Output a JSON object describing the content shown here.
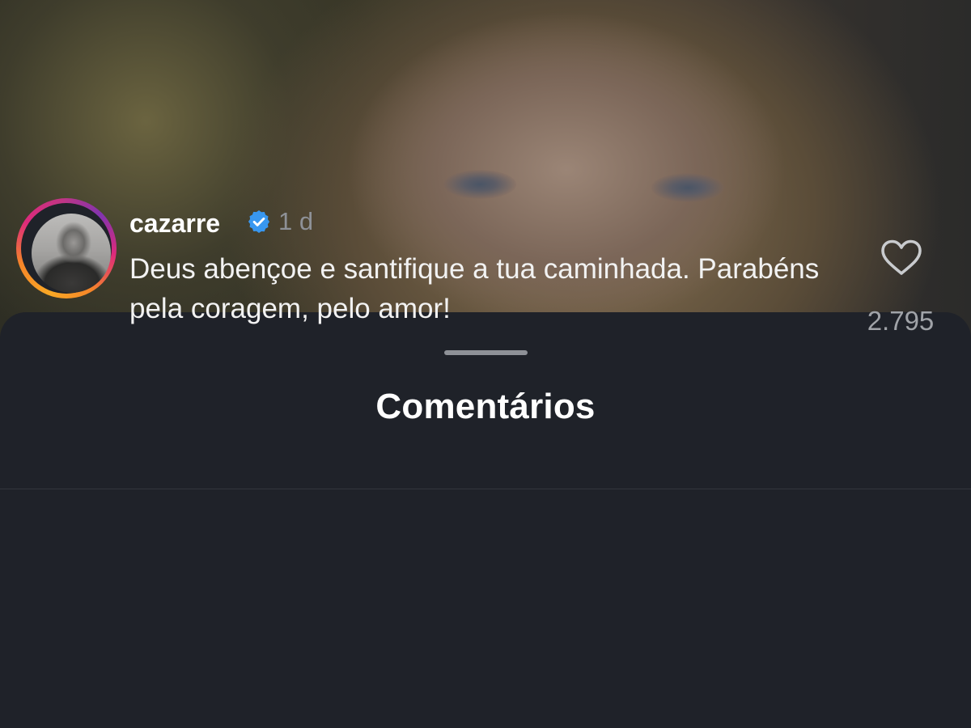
{
  "sheet": {
    "title": "Comentários"
  },
  "comment": {
    "username": "cazarre",
    "verified": true,
    "time": "1 d",
    "text": "Deus abençoe e santifique a tua caminhada. Parabéns pela coragem, pelo amor!",
    "likes": "2.795"
  },
  "icons": {
    "verified": "verified-badge-icon",
    "like": "heart-icon"
  },
  "colors": {
    "sheet_bg": "#1f2229",
    "verified_blue": "#3897f0",
    "muted_text": "#8e9197"
  }
}
